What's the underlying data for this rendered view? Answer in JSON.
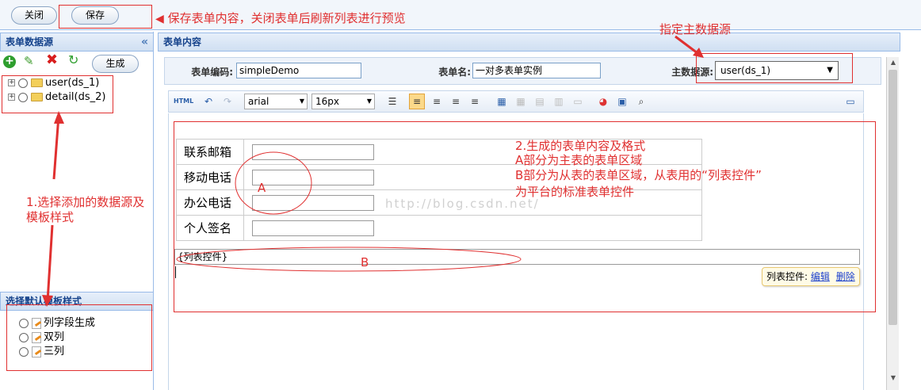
{
  "toolbar": {
    "close_label": "关闭",
    "save_label": "保存"
  },
  "left": {
    "datasource_title": "表单数据源",
    "generate_label": "生成",
    "datasources": [
      {
        "label": "user(ds_1)"
      },
      {
        "label": "detail(ds_2)"
      }
    ],
    "template_title": "选择默认模板样式",
    "templates": [
      {
        "label": "列字段生成"
      },
      {
        "label": "双列"
      },
      {
        "label": "三列"
      }
    ]
  },
  "main": {
    "title": "表单内容",
    "form_code_label": "表单编码:",
    "form_code_value": "simpleDemo",
    "form_name_label": "表单名:",
    "form_name_value": "一对多表单实例",
    "master_label": "主数据源:",
    "master_value": "user(ds_1)"
  },
  "editor": {
    "font_family": "arial",
    "font_size": "16px",
    "html_label": "HTML"
  },
  "form_fields": [
    {
      "label": "联系邮箱"
    },
    {
      "label": "移动电话"
    },
    {
      "label": "办公电话"
    },
    {
      "label": "个人签名"
    }
  ],
  "list_control": {
    "text": "{列表控件}",
    "popup_label": "列表控件:",
    "edit_link": "编辑",
    "delete_link": "删除"
  },
  "watermark": "http://blog.csdn.net/",
  "annotations": {
    "save_note": "保存表单内容，关闭表单后刷新列表进行预览",
    "master_note": "指定主数据源",
    "step1_line1": "1.选择添加的数据源及",
    "step1_line2": "模板样式",
    "step2_line1": "2.生成的表单内容及格式",
    "step2_line2": "A部分为主表的表单区域",
    "step2_line3": "B部分为从表的表单区域，从表用的“列表控件”",
    "step2_line4": "为平台的标准表单控件",
    "label_a": "A",
    "label_b": "B"
  },
  "colors": {
    "accent_red": "#e03030",
    "panel_blue": "#99bbe8",
    "header_text": "#15428b"
  }
}
